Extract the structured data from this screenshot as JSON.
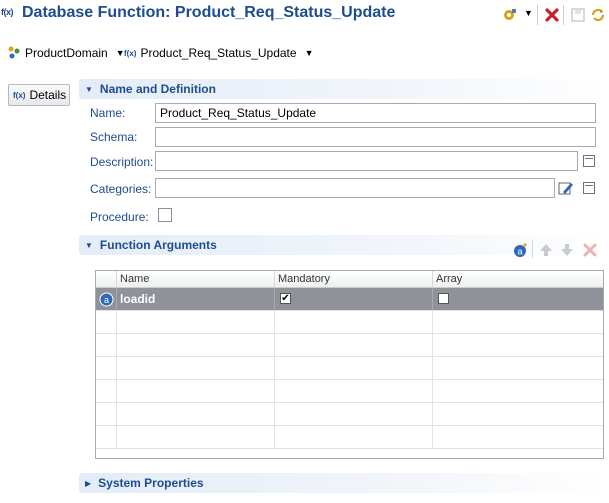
{
  "editor": {
    "icon_glyph": "f(x)",
    "title": "Database Function: Product_Req_Status_Update",
    "toolbar": [
      {
        "name": "run-icon",
        "color": "#d4a21a"
      },
      {
        "name": "delete-icon",
        "color": "#c9202b"
      },
      {
        "name": "save-icon",
        "color": "#c5c9ce"
      },
      {
        "name": "refresh-icon",
        "color": "#d4a21a"
      }
    ]
  },
  "breadcrumb": {
    "domain": "ProductDomain",
    "function": "Product_Req_Status_Update"
  },
  "side_tabs": [
    {
      "icon": "f(x)",
      "label": "Details"
    }
  ],
  "sections": {
    "name_def": "Name and Definition",
    "args": "Function Arguments",
    "sys": "System Properties"
  },
  "form": {
    "name_label": "Name:",
    "name_value": "Product_Req_Status_Update",
    "schema_label": "Schema:",
    "schema_value": "",
    "description_label": "Description:",
    "description_value": "",
    "categories_label": "Categories:",
    "categories_value": "",
    "procedure_label": "Procedure:",
    "procedure_checked": false
  },
  "args_table": {
    "columns": [
      "Name",
      "Mandatory",
      "Array"
    ],
    "rows": [
      {
        "name": "loadid",
        "mandatory": true,
        "array": false
      }
    ],
    "empty_rows": 6
  }
}
